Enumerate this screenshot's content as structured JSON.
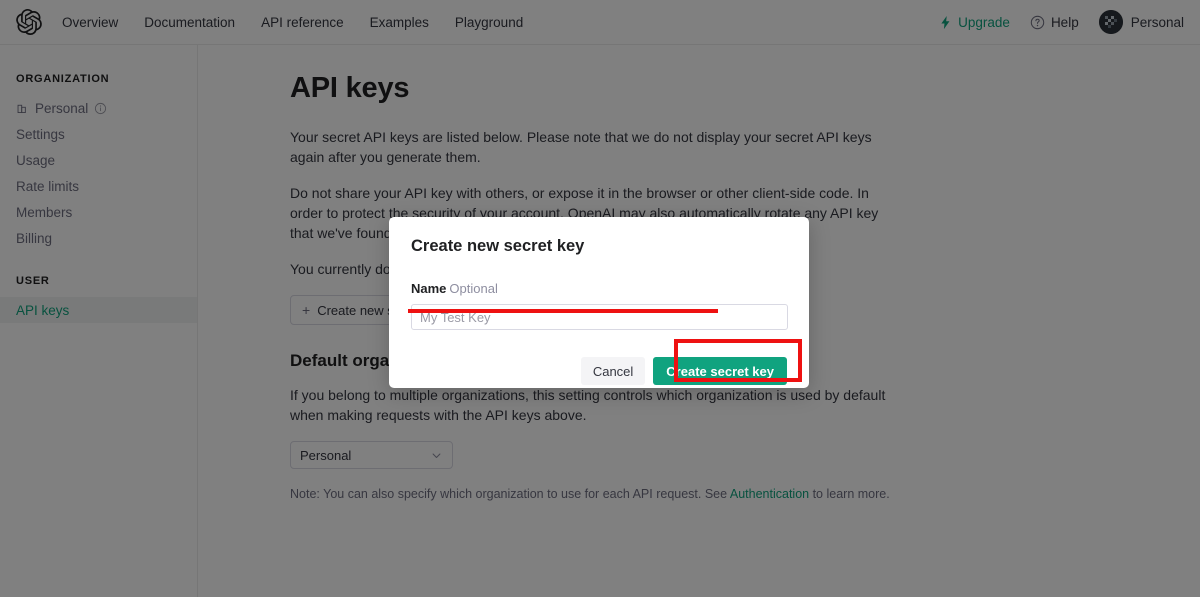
{
  "topnav": {
    "logo_icon": "openai-logo-icon",
    "links": [
      {
        "label": "Overview"
      },
      {
        "label": "Documentation"
      },
      {
        "label": "API reference"
      },
      {
        "label": "Examples"
      },
      {
        "label": "Playground"
      }
    ],
    "upgrade": {
      "label": "Upgrade",
      "icon": "lightning-bolt-icon",
      "color": "#10a37f"
    },
    "help": {
      "label": "Help",
      "icon": "question-circle-icon"
    },
    "account": {
      "label": "Personal",
      "icon": "avatar-identicon"
    }
  },
  "sidebar": {
    "organization_title": "ORGANIZATION",
    "user_title": "USER",
    "org_items": [
      {
        "label": "Personal",
        "icon": "building-icon",
        "trailing_icon": "info-circle-icon",
        "active": false
      },
      {
        "label": "Settings",
        "active": false
      },
      {
        "label": "Usage",
        "active": false
      },
      {
        "label": "Rate limits",
        "active": false
      },
      {
        "label": "Members",
        "active": false
      },
      {
        "label": "Billing",
        "active": false
      }
    ],
    "user_items": [
      {
        "label": "API keys",
        "active": true
      }
    ],
    "active_color": "#10a37f"
  },
  "main": {
    "title": "API keys",
    "paragraph_1": "Your secret API keys are listed below. Please note that we do not display your secret API keys again after you generate them.",
    "paragraph_2": "Do not share your API key with others, or expose it in the browser or other client-side code. In order to protect the security of your account, OpenAI may also automatically rotate any API key that we've found has leaked publicly.",
    "no_keys_text": "You currently do not have any API keys",
    "create_key_button": "Create new secret key",
    "create_key_icon": "plus-icon",
    "default_org": {
      "heading": "Default organization",
      "description": "If you belong to multiple organizations, this setting controls which organization is used by default when making requests with the API keys above.",
      "selected": "Personal",
      "chevron_icon": "chevron-down-icon",
      "note_prefix": "Note: You can also specify which organization to use for each API request. See ",
      "note_link": "Authentication",
      "note_suffix": " to learn more."
    }
  },
  "modal": {
    "title": "Create new secret key",
    "field_label": "Name",
    "field_optional": "Optional",
    "input_value": "",
    "input_placeholder": "My Test Key",
    "cancel_label": "Cancel",
    "submit_label": "Create secret key",
    "submit_color": "#10a37f"
  },
  "annotations": {
    "color": "#ee1111",
    "underline_target": "name-input",
    "box_target": "create-secret-key-button"
  }
}
